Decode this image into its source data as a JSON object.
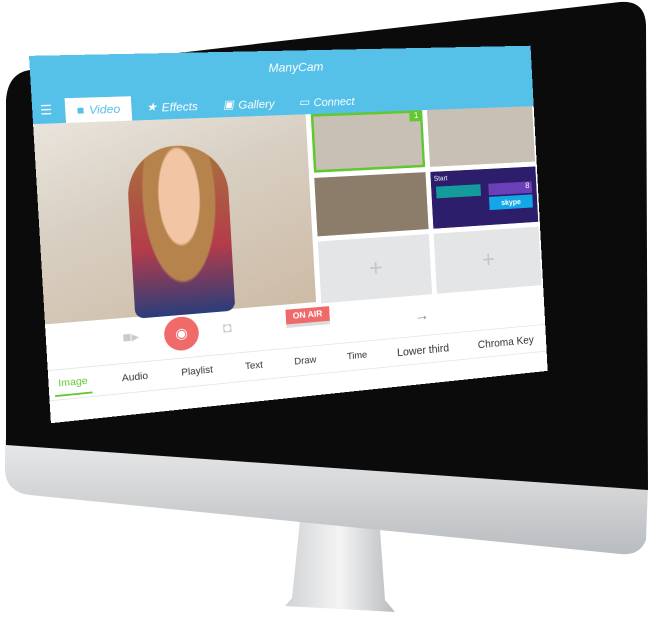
{
  "app": {
    "title": "ManyCam"
  },
  "tabs": [
    {
      "label": "Video",
      "icon": "video-camera-icon",
      "active": true
    },
    {
      "label": "Effects",
      "icon": "star-icon"
    },
    {
      "label": "Gallery",
      "icon": "image-icon"
    },
    {
      "label": "Connect",
      "icon": "connect-icon"
    }
  ],
  "sources": {
    "selected_badge": "1",
    "windows_start_label": "Start",
    "windows_tile_number": "8",
    "skype_label": "skype",
    "add_symbol": "+"
  },
  "controls": {
    "on_air": "ON AIR",
    "arrow": "→"
  },
  "bottom_tabs": [
    {
      "label": "Image",
      "active": true
    },
    {
      "label": "Audio"
    },
    {
      "label": "Playlist"
    },
    {
      "label": "Text"
    },
    {
      "label": "Draw"
    },
    {
      "label": "Time"
    },
    {
      "label": "Lower third"
    },
    {
      "label": "Chroma Key"
    }
  ],
  "colors": {
    "accent": "#55c0e8",
    "active": "#62c832",
    "record": "#f06a6a"
  }
}
